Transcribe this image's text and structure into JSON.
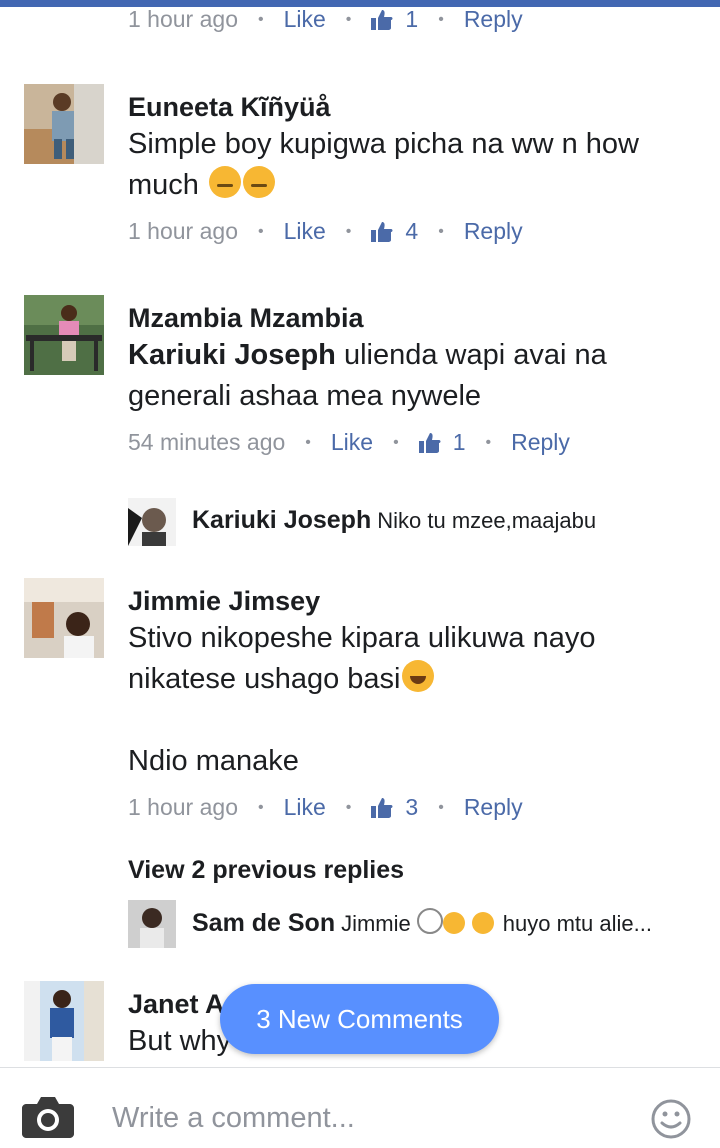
{
  "comments": [
    {
      "meta": {
        "time": "1 hour ago",
        "like": "Like",
        "likes": "1",
        "reply": "Reply"
      }
    },
    {
      "name": "Euneeta Kĩñyüå",
      "text": "Simple boy kupigwa picha na ww n how much",
      "meta": {
        "time": "1 hour ago",
        "like": "Like",
        "likes": "4",
        "reply": "Reply"
      }
    },
    {
      "name": "Mzambia Mzambia",
      "tag": "Kariuki Joseph",
      "text": " ulienda wapi avai na generali ashaa mea nywele",
      "meta": {
        "time": "54 minutes ago",
        "like": "Like",
        "likes": "1",
        "reply": "Reply"
      },
      "reply": {
        "name": "Kariuki Joseph",
        "text": "Niko tu mzee,maajabu"
      }
    },
    {
      "name": "Jimmie Jimsey",
      "text_line1": "Stivo nikopeshe kipara ulikuwa nayo nikatese ushago basi",
      "text_line2": "Ndio manake",
      "meta": {
        "time": "1 hour ago",
        "like": "Like",
        "likes": "3",
        "reply": "Reply"
      },
      "view_previous": "View 2 previous replies",
      "reply": {
        "name": "Sam de Son",
        "text_a": "Jimmie",
        "text_b": "huyo mtu alie..."
      }
    },
    {
      "name": "Janet A",
      "text": "But why"
    }
  ],
  "new_comments_pill": "3 New Comments",
  "composer": {
    "placeholder": "Write a comment..."
  },
  "colors": {
    "brand_blue": "#4267b2",
    "link": "#4b6aa8",
    "pill": "#5890ff",
    "meta_gray": "#90949c"
  },
  "icons": [
    "thumbs-up-icon",
    "camera-icon",
    "smiley-icon"
  ]
}
